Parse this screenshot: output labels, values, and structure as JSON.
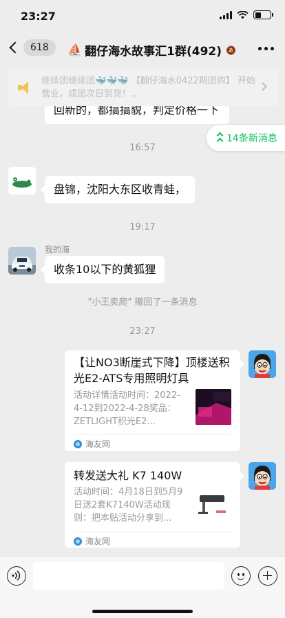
{
  "status_bar": {
    "time": "23:27"
  },
  "nav": {
    "unread_count": "618",
    "title": "翻仔海水故事汇1群(492)",
    "boat_icon": "sailboat-icon",
    "mute_icon": "mute-bell-icon"
  },
  "announcement": {
    "text": "继续团继续团🐳🐳🐳 【翻仔海水0422期团购】 开始营业，成团次日到货！..."
  },
  "new_messages_badge": "14条新消息",
  "messages": {
    "cut_top_text": "回新的，都搞搞貌，判定价格一下",
    "time1": "16:57",
    "msg1_text": "盘锦，沈阳大东区收青蛙，",
    "time2": "19:17",
    "msg2_sender": "我的海",
    "msg2_text": "收条10以下的黄狐狸",
    "recall_notice": "\"小王卖爬\" 撤回了一条消息",
    "time3": "23:27"
  },
  "cards": [
    {
      "title": "【让NO3断崖式下降】顶楼送积光E2-ATS专用照明灯具",
      "desc": "活动详情活动时间：2022-4-12到2022-4-28奖品：ZETLIGHT积光E2...",
      "source": "海友网",
      "thumb_text": "NO₃断崖\n50天"
    },
    {
      "title": "转发送大礼 K7 140W",
      "desc": "活动时间：4月18日到5月9日送2套K7140W活动规则：把本贴活动分享到...",
      "source": "海友网"
    }
  ],
  "colors": {
    "accent": "#07c160",
    "background": "#ededed",
    "bubble": "#ffffff"
  }
}
